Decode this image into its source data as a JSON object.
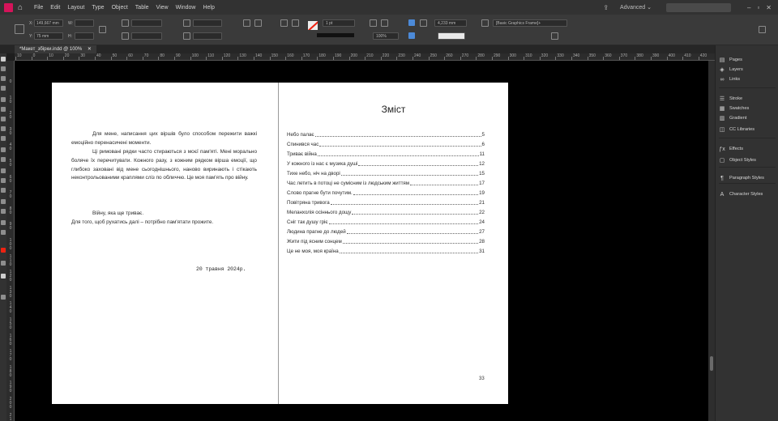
{
  "menubar": {
    "app_badge": "Id",
    "home_icon": "home-icon",
    "items": [
      "File",
      "Edit",
      "Layout",
      "Type",
      "Object",
      "Table",
      "View",
      "Window",
      "Help"
    ],
    "share_icon": "share-icon",
    "workspace": "Advanced ⌄",
    "window_controls": [
      "–",
      "▫",
      "✕"
    ]
  },
  "control": {
    "x_label": "X:",
    "x_value": "149,667 mm",
    "y_label": "Y:",
    "y_value": "75 mm",
    "w_label": "W:",
    "h_label": "H:",
    "stroke_weight": "1 pt",
    "opacity": "100%",
    "dimension": "4,233 mm",
    "frame_style": "[Basic Graphics Frame]+"
  },
  "document": {
    "tab_title": "*Макет_збірки.indd @ 100%",
    "close_icon": "✕"
  },
  "ruler_top": [
    "10",
    "0",
    "10",
    "20",
    "30",
    "40",
    "50",
    "60",
    "70",
    "80",
    "90",
    "100",
    "110",
    "120",
    "130",
    "140",
    "150",
    "160",
    "170",
    "180",
    "190",
    "200",
    "210",
    "220",
    "230",
    "240",
    "250",
    "260",
    "270",
    "280",
    "290",
    "300",
    "310",
    "320",
    "330",
    "340",
    "350",
    "360",
    "370",
    "380",
    "390",
    "400",
    "410",
    "420"
  ],
  "ruler_left": [
    "0",
    "1 0",
    "2 0",
    "3 0",
    "4 0",
    "5 0",
    "6 0",
    "7 0",
    "8 0",
    "9 0",
    "1 0 0",
    "1 1 0",
    "1 2 0",
    "1 3 0",
    "1 4 0",
    "1 5 0",
    "1 6 0",
    "1 7 0",
    "1 8 0",
    "1 9 0",
    "2 0 0",
    "2 1 0"
  ],
  "left_page": {
    "paragraphs": [
      "Для мене, написання цих віршів було способом пережити важкі емоційно перенасичені моменти.",
      "Ці римовані рядки часто стираються з моєї пам'яті. Мені морально боляче їх перечитувати. Кожного разу, з кожним рядком вірша емоції, що глибоко заховані від мене сьогоднішнього, наново виринають і стікають неконтрольованими краплями сліз по обличчю. Це моя пам'ять про війну.",
      "Війну, яка ще триває.",
      "Для того, щоб рухатись далі – потрібно пам'ятати прожите."
    ],
    "date": "20 травня 2024р."
  },
  "right_page": {
    "title": "Зміст",
    "toc": [
      {
        "title": "Небо палає",
        "page": "5"
      },
      {
        "title": "Спинився час",
        "page": "6"
      },
      {
        "title": "Триває війна",
        "page": "11"
      },
      {
        "title": "У кожного із нас є музика душі",
        "page": "12"
      },
      {
        "title": "Тихе небо, ніч на дворі",
        "page": "15"
      },
      {
        "title": "Час летить в потоці не сумісним із людським життям",
        "page": "17"
      },
      {
        "title": "Слово прагне бути почутим.",
        "page": "19"
      },
      {
        "title": "Повітряна тривога",
        "page": "21"
      },
      {
        "title": "Меланхолія осіннього дощу",
        "page": "22"
      },
      {
        "title": "Сніг так душу гріє",
        "page": "24"
      },
      {
        "title": "Людина прагне до людей",
        "page": "27"
      },
      {
        "title": "Жити під ясним сонцем",
        "page": "28"
      },
      {
        "title": "Це не моя, моя країна",
        "page": "31"
      }
    ],
    "page_number": "33"
  },
  "panels": [
    {
      "label": "Pages",
      "icon": "pages-icon",
      "glyph": "▤"
    },
    {
      "label": "Layers",
      "icon": "layers-icon",
      "glyph": "◈"
    },
    {
      "label": "Links",
      "icon": "links-icon",
      "glyph": "∞"
    },
    {
      "label": "Stroke",
      "icon": "stroke-icon",
      "glyph": "☰"
    },
    {
      "label": "Swatches",
      "icon": "swatches-icon",
      "glyph": "▦"
    },
    {
      "label": "Gradient",
      "icon": "gradient-icon",
      "glyph": "▥"
    },
    {
      "label": "CC Libraries",
      "icon": "cc-libraries-icon",
      "glyph": "◫"
    },
    {
      "label": "Effects",
      "icon": "effects-icon",
      "glyph": "ƒx"
    },
    {
      "label": "Object Styles",
      "icon": "object-styles-icon",
      "glyph": "▢"
    },
    {
      "label": "Paragraph Styles",
      "icon": "paragraph-styles-icon",
      "glyph": "¶"
    },
    {
      "label": "Character Styles",
      "icon": "character-styles-icon",
      "glyph": "A"
    }
  ],
  "colors": {
    "accent": "#d4145a",
    "pasteboard": "#000000",
    "panel": "#323232"
  }
}
